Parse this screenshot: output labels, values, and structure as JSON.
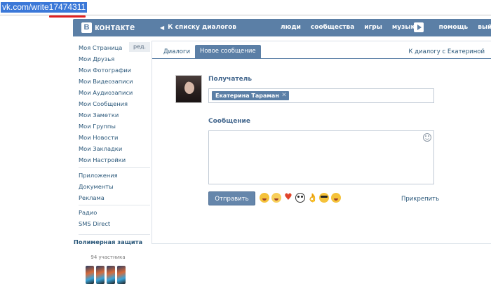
{
  "browser": {
    "url": "vk.com/write17474311"
  },
  "header": {
    "logo_letter": "В",
    "logo_text": "контакте",
    "back_link": "К списку диалогов",
    "nav": [
      "люди",
      "сообщества",
      "игры",
      "музыка",
      "помощь",
      "выйти"
    ]
  },
  "sidebar": {
    "edit_label": "ред.",
    "items": [
      "Моя Страница",
      "Мои Друзья",
      "Мои Фотографии",
      "Мои Видеозаписи",
      "Мои Аудиозаписи",
      "Мои Сообщения",
      "Мои Заметки",
      "Мои Группы",
      "Мои Новости",
      "Мои Закладки",
      "Мои Настройки"
    ],
    "items2": [
      "Приложения",
      "Документы",
      "Реклама"
    ],
    "items3": [
      "Радио",
      "SMS Direct"
    ],
    "promo_title": "Полимерная защита",
    "promo_subtitle": "94 участника"
  },
  "main": {
    "tabs": [
      {
        "label": "Диалоги"
      },
      {
        "label": "Новое сообщение"
      }
    ],
    "to_dialog_link": "К диалогу с Екатериной",
    "recipient_label": "Получатель",
    "recipient_name": "Екатерина Тараман",
    "message_label": "Сообщение",
    "message_value": "",
    "send_label": "Отправить",
    "attach_label": "Прикрепить",
    "emoji": [
      "laughing-icon",
      "grinning-icon",
      "heart-icon",
      "panda-icon",
      "ok-hand-icon",
      "sunglasses-icon",
      "scream-icon"
    ]
  },
  "colors": {
    "brand": "#5b7fa6",
    "link": "#2b587a",
    "label": "#45688e",
    "url_highlight": "#3b78d8",
    "underline": "#e02020"
  }
}
